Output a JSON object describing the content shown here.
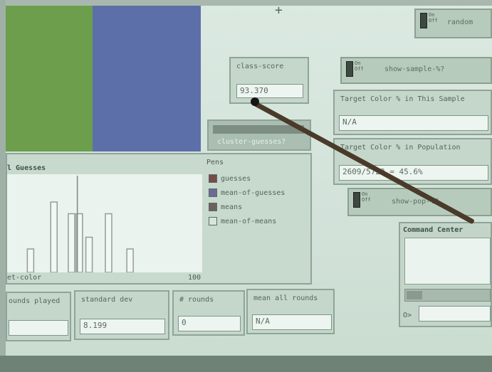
{
  "monitors": {
    "class_score": {
      "label": "class-score",
      "value": "93.370"
    },
    "target_sample": {
      "label": "Target Color % in This Sample",
      "value": "N/A"
    },
    "target_population": {
      "label": "Target Color % in Population",
      "value": "2609/5723 = 45.6%"
    },
    "rounds_played": {
      "label": "ounds played",
      "value": ""
    },
    "standard_dev": {
      "label": "standard dev",
      "value": "8.199"
    },
    "num_rounds": {
      "label": "# rounds",
      "value": "0"
    },
    "mean_all_rounds": {
      "label": "mean all rounds",
      "value": "N/A"
    }
  },
  "switches": {
    "top_right": {
      "name": "random",
      "on": "On",
      "off": "Off"
    },
    "show_sample": {
      "name": "show-sample-%?",
      "on": "On",
      "off": "Off"
    },
    "show_pop": {
      "name": "show-pop-%?",
      "on": "On",
      "off": "Off"
    }
  },
  "chooser": {
    "label": "cluster-guesses?"
  },
  "plot": {
    "title": "l Guesses",
    "xlabel": "et-color",
    "xmax": "100",
    "pens_title": "Pens",
    "pens": [
      {
        "name": "guesses",
        "color": "#7a4a4a"
      },
      {
        "name": "mean-of-guesses",
        "color": "#6c6a9a"
      },
      {
        "name": "means",
        "color": "#6e6060"
      },
      {
        "name": "mean-of-means",
        "color": "#d6e6dc"
      }
    ]
  },
  "chart_data": {
    "type": "bar",
    "title": "l Guesses",
    "xlabel": "et-color",
    "x": [
      12,
      24,
      33,
      37,
      42,
      52,
      63
    ],
    "values": [
      2,
      6,
      5,
      5,
      3,
      5,
      2
    ],
    "xlim": [
      0,
      100
    ],
    "reference_line_x": 36
  },
  "command_center": {
    "title": "Command Center",
    "prompt": "O>"
  }
}
